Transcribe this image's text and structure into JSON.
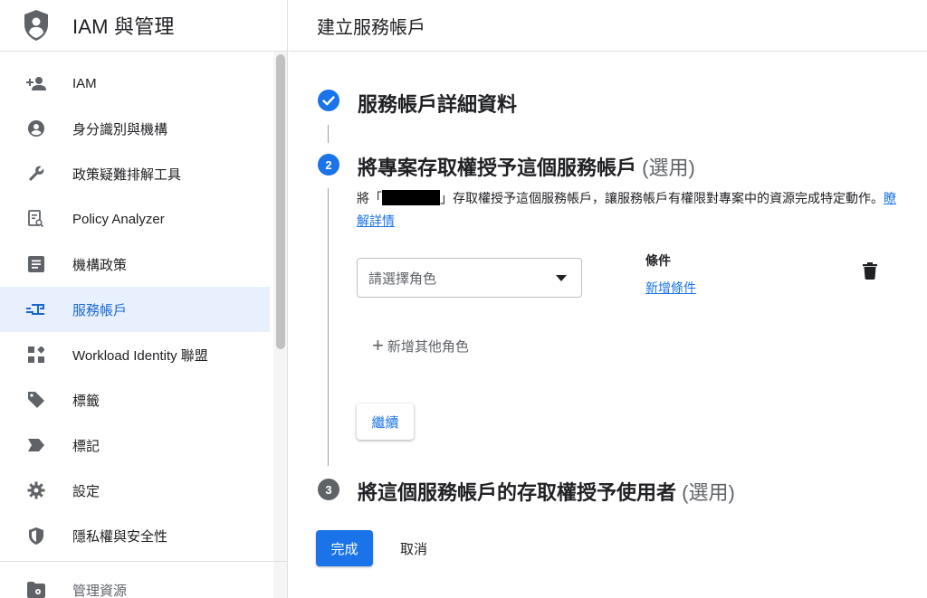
{
  "sidebar": {
    "title": "IAM 與管理",
    "logo_icon": "shield-person-icon",
    "items": [
      {
        "label": "IAM",
        "icon": "person-add-icon"
      },
      {
        "label": "身分識別與機構",
        "icon": "account-circle-icon"
      },
      {
        "label": "政策疑難排解工具",
        "icon": "wrench-icon"
      },
      {
        "label": "Policy Analyzer",
        "icon": "policy-search-icon"
      },
      {
        "label": "機構政策",
        "icon": "list-box-icon"
      },
      {
        "label": "服務帳戶",
        "icon": "service-account-icon",
        "active": true
      },
      {
        "label": "Workload Identity 聯盟",
        "icon": "workload-grid-icon"
      },
      {
        "label": "標籤",
        "icon": "tag-icon"
      },
      {
        "label": "標記",
        "icon": "label-icon"
      },
      {
        "label": "設定",
        "icon": "gear-icon"
      },
      {
        "label": "隱私權與安全性",
        "icon": "privacy-shield-icon"
      },
      {
        "label": "管理資源",
        "icon": "folder-gear-icon"
      }
    ]
  },
  "main": {
    "title": "建立服務帳戶",
    "step1": {
      "title": "服務帳戶詳細資料",
      "icon": "check-circle-icon"
    },
    "step2": {
      "number": "2",
      "title": "將專案存取權授予這個服務帳戶",
      "optional": "(選用)",
      "desc_prefix": "將「",
      "desc_suffix": "」存取權授予這個服務帳戶，讓服務帳戶有權限對專案中的資源完成特定動作。",
      "learn_more": "瞭解詳情",
      "role_placeholder": "請選擇角色",
      "condition_label": "條件",
      "add_condition": "新增條件",
      "add_role": "新增其他角色",
      "continue": "繼續"
    },
    "step3": {
      "number": "3",
      "title": "將這個服務帳戶的存取權授予使用者",
      "optional": "(選用)"
    },
    "done": "完成",
    "cancel": "取消"
  },
  "colors": {
    "accent": "#1a73e8",
    "active_bg": "#e8f0fe",
    "step_inactive": "#5f6368"
  }
}
